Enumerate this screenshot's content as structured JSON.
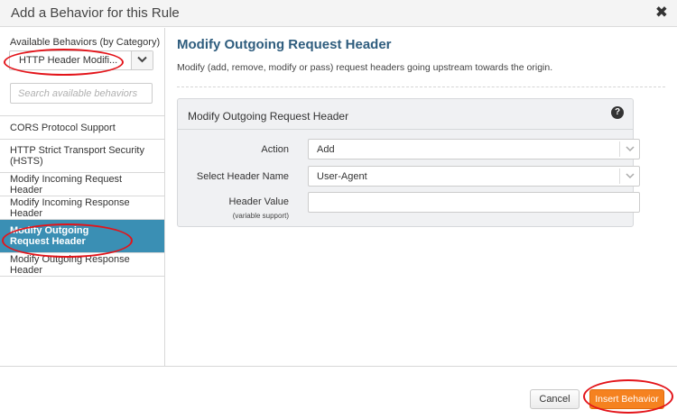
{
  "dialog": {
    "title": "Add a Behavior for this Rule",
    "close_glyph": "✖"
  },
  "sidebar": {
    "category_label": "Available Behaviors (by Category)",
    "category_value": "HTTP Header Modifi...",
    "search_placeholder": "Search available behaviors",
    "items": [
      {
        "label": "CORS Protocol Support",
        "active": false
      },
      {
        "label": "HTTP Strict Transport Security (HSTS)",
        "active": false
      },
      {
        "label": "Modify Incoming Request Header",
        "active": false
      },
      {
        "label": "Modify Incoming Response Header",
        "active": false
      },
      {
        "label": "Modify Outgoing Request Header",
        "active": true
      },
      {
        "label": "Modify Outgoing Response Header",
        "active": false
      }
    ]
  },
  "main": {
    "title": "Modify Outgoing Request Header",
    "description": "Modify (add, remove, modify or pass) request headers going upstream towards the origin.",
    "panel": {
      "title": "Modify Outgoing Request Header",
      "help_glyph": "?",
      "action_label": "Action",
      "action_value": "Add",
      "header_name_label": "Select Header Name",
      "header_name_value": "User-Agent",
      "header_value_label": "Header Value",
      "header_value_sub": "(variable support)",
      "header_value": ""
    }
  },
  "footer": {
    "cancel_label": "Cancel",
    "insert_label": "Insert Behavior"
  },
  "colors": {
    "active_item": "#3a8fb4",
    "title_blue": "#2f5d7e",
    "insert_orange": "#f58220",
    "annotation_red": "#e3141a"
  }
}
